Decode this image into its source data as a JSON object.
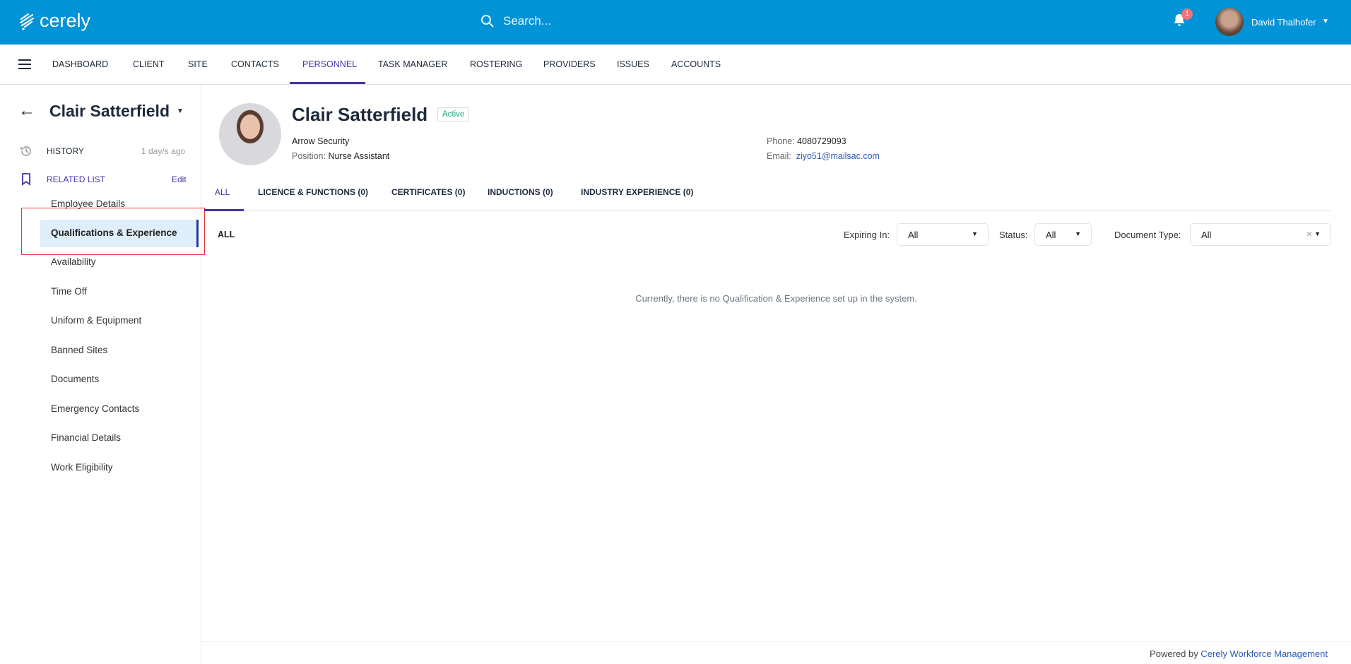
{
  "header": {
    "logo": "cerely",
    "search_placeholder": "Search...",
    "notifications": "1",
    "user_name": "David Thalhofer"
  },
  "nav": {
    "items": [
      "DASHBOARD",
      "CLIENT",
      "SITE",
      "CONTACTS",
      "PERSONNEL",
      "TASK MANAGER",
      "ROSTERING",
      "PROVIDERS",
      "ISSUES",
      "ACCOUNTS"
    ],
    "active": "PERSONNEL"
  },
  "sidebar": {
    "name": "Clair Satterfield",
    "history_label": "HISTORY",
    "history_time": "1 day/s ago",
    "related_label": "RELATED LIST",
    "edit_label": "Edit",
    "items": [
      "Employee Details",
      "Qualifications & Experience",
      "Availability",
      "Time Off",
      "Uniform & Equipment",
      "Banned Sites",
      "Documents",
      "Emergency Contacts",
      "Financial Details",
      "Work Eligibility"
    ],
    "selected": "Qualifications & Experience"
  },
  "profile": {
    "name": "Clair Satterfield",
    "status": "Active",
    "company": "Arrow Security",
    "position_label": "Position:",
    "position": "Nurse Assistant",
    "phone_label": "Phone:",
    "phone": "4080729093",
    "email_label": "Email:",
    "email": "ziyo51@mailsac.com"
  },
  "tabs": [
    "ALL",
    "LICENCE & FUNCTIONS (0)",
    "CERTIFICATES (0)",
    "INDUCTIONS (0)",
    "INDUSTRY EXPERIENCE (0)"
  ],
  "section_title": "ALL",
  "filters": {
    "expiring_label": "Expiring In:",
    "expiring_value": "All",
    "status_label": "Status:",
    "status_value": "All",
    "doctype_label": "Document Type:",
    "doctype_value": "All"
  },
  "empty_message": "Currently, there is no Qualification & Experience set up in the system.",
  "footer": {
    "prefix": "Powered by",
    "link": "Cerely Workforce Management"
  },
  "colors": {
    "header": "#0093d8",
    "accent": "#4535a8",
    "active_status": "#1aa37a"
  }
}
